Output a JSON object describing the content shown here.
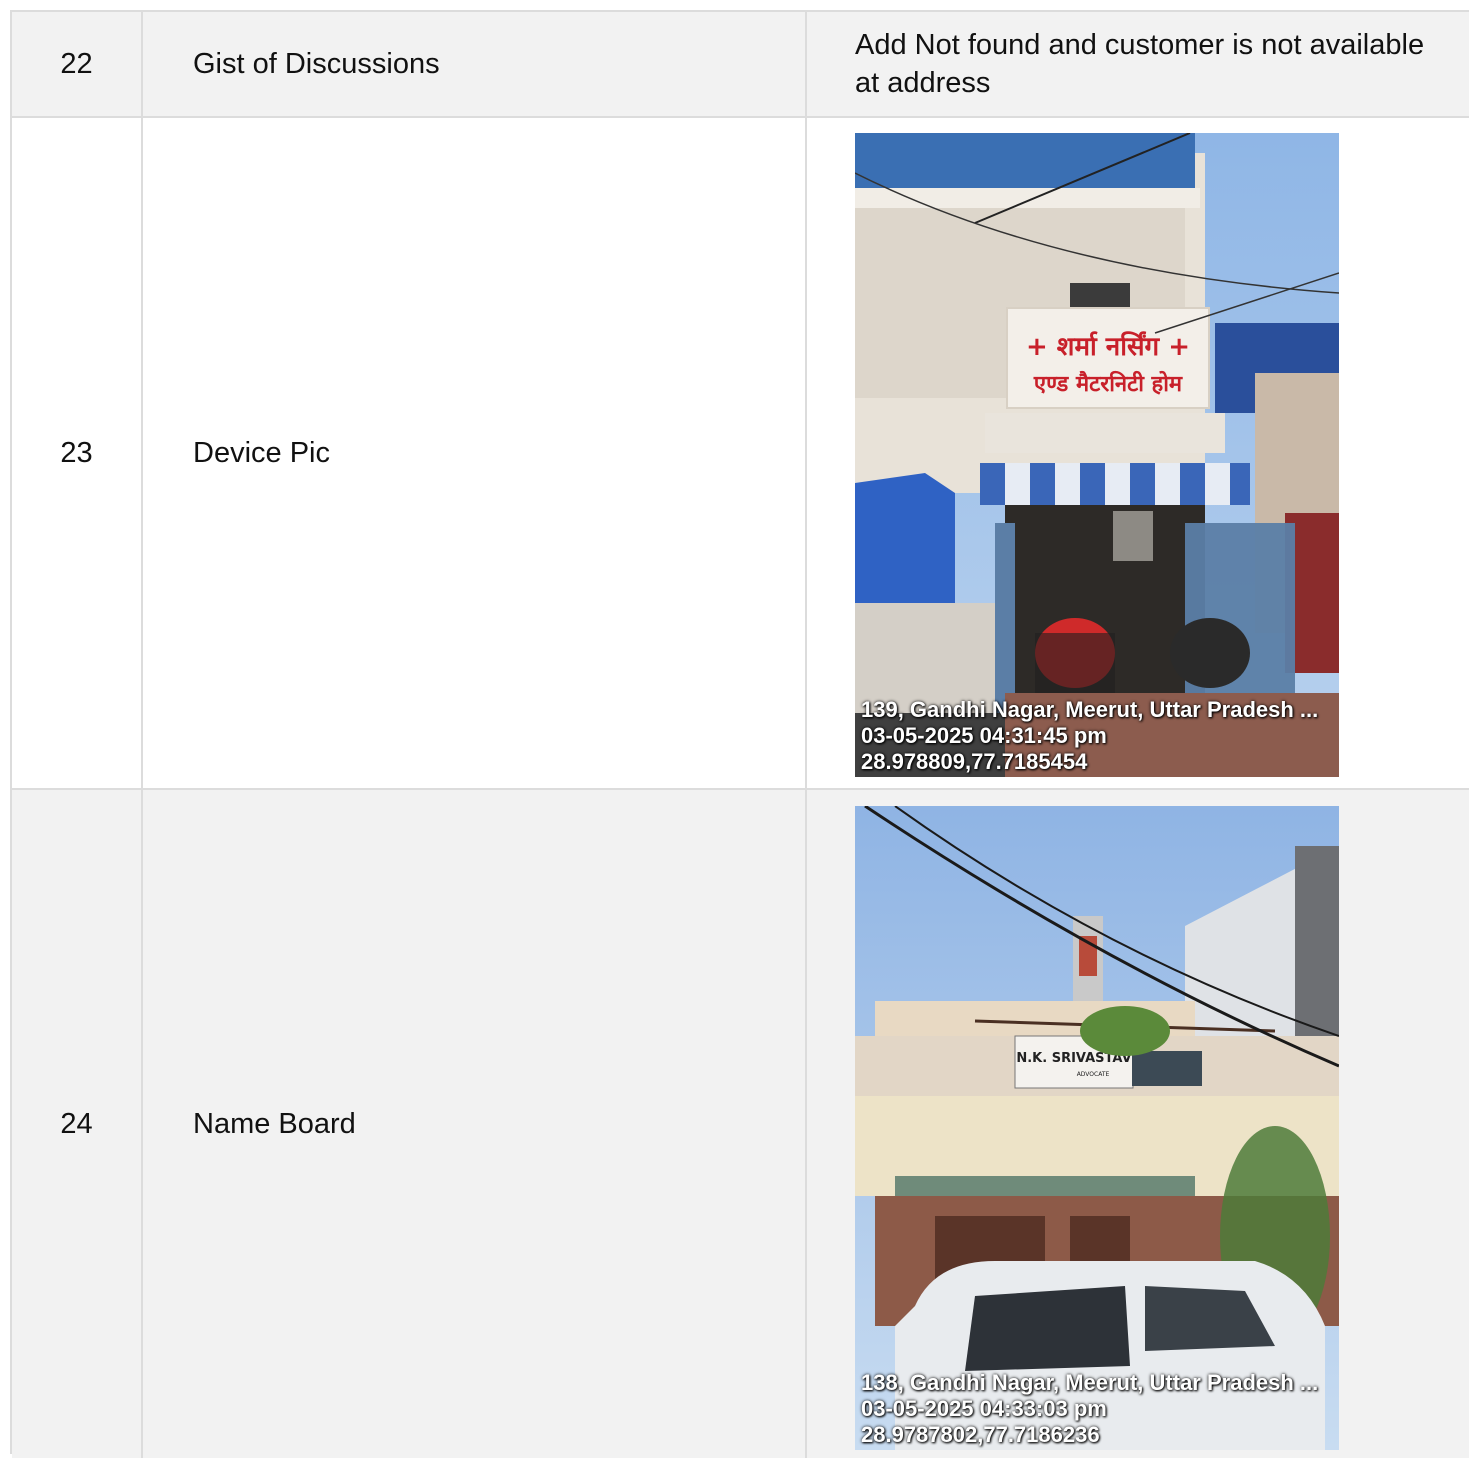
{
  "rows": [
    {
      "no": "22",
      "label": "Gist of Discussions",
      "value": "Add Not found and customer is not available at address"
    },
    {
      "no": "23",
      "label": "Device Pic",
      "photo": {
        "sign_line1": "+ शर्मा नर्सिंग +",
        "sign_line2": "एण्ड मैटरनिटी होम",
        "overlay": {
          "address": "139, Gandhi Nagar, Meerut, Uttar Pradesh ...",
          "datetime": "03-05-2025 04:31:45 pm",
          "coords": "28.978809,77.7185454"
        }
      }
    },
    {
      "no": "24",
      "label": "Name Board",
      "photo": {
        "sign_name": "N.K. SRIVASTAV",
        "sign_title": "ADVOCATE",
        "overlay": {
          "address": "138, Gandhi Nagar, Meerut, Uttar Pradesh ...",
          "datetime": "03-05-2025 04:33:03 pm",
          "coords": "28.9787802,77.7186236"
        }
      }
    }
  ]
}
